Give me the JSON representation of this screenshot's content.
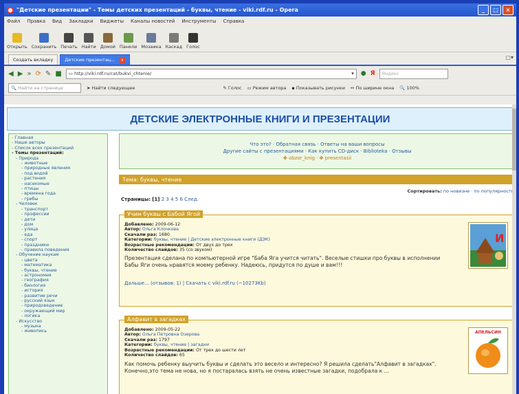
{
  "window": {
    "title": "\"Детские презентации\" - Темы детских презентаций - буквы, чтение - viki.rdf.ru - Opera"
  },
  "menu": [
    "Файл",
    "Правка",
    "Вид",
    "Закладки",
    "Виджеты",
    "Каналы новостей",
    "Инструменты",
    "Справка"
  ],
  "toolbar": [
    "Открыть",
    "Сохранить",
    "Печать",
    "Найти",
    "Домой",
    "Панели",
    "Мозаика",
    "Каскад",
    "Голос"
  ],
  "tabs": [
    {
      "label": "Создать вкладку"
    },
    {
      "label": "Детские презентац...",
      "close": "x"
    }
  ],
  "address": {
    "url": "http://viki.rdf.ru/cat/bukvi_chtenie/",
    "search_placeholder": "Яндекс"
  },
  "findbar": {
    "input": "Найти на странице",
    "find_next": "Найти следующее",
    "voice": "Голос",
    "author_mode": "Режим автора",
    "show_images": "Показывать рисунки",
    "fit_width": "По ширине окна",
    "zoom": "100%"
  },
  "page": {
    "banner": "ДЕТСКИЕ ЭЛЕКТРОННЫЕ КНИГИ И ПРЕЗЕНТАЦИИ",
    "sidebar": [
      {
        "t": "- Главная",
        "c": "l0"
      },
      {
        "t": "- Наши авторы",
        "c": "l0"
      },
      {
        "t": "- Список всех презентаций",
        "c": "l0"
      },
      {
        "t": "- Темы презентаций:",
        "c": "b"
      },
      {
        "t": "- Природа",
        "c": "l1"
      },
      {
        "t": "- животные",
        "c": "l2"
      },
      {
        "t": "- природные явления",
        "c": "l2"
      },
      {
        "t": "- под водой",
        "c": "l2"
      },
      {
        "t": "- растения",
        "c": "l2"
      },
      {
        "t": "- насекомые",
        "c": "l2"
      },
      {
        "t": "- птицы",
        "c": "l2"
      },
      {
        "t": "- времена года",
        "c": "l2"
      },
      {
        "t": "- грибы",
        "c": "l2"
      },
      {
        "t": "- Человек",
        "c": "l1"
      },
      {
        "t": "- транспорт",
        "c": "l2"
      },
      {
        "t": "- профессии",
        "c": "l2"
      },
      {
        "t": "- дети",
        "c": "l2"
      },
      {
        "t": "- дом",
        "c": "l2"
      },
      {
        "t": "- улица",
        "c": "l2"
      },
      {
        "t": "- еда",
        "c": "l2"
      },
      {
        "t": "- спорт",
        "c": "l2"
      },
      {
        "t": "- праздники",
        "c": "l2"
      },
      {
        "t": "- правила поведения",
        "c": "l2"
      },
      {
        "t": "- Обучение наукам",
        "c": "l1"
      },
      {
        "t": "- цвета",
        "c": "l2"
      },
      {
        "t": "- математика",
        "c": "l2"
      },
      {
        "t": "- буквы, чтение",
        "c": "l2"
      },
      {
        "t": "- астрономия",
        "c": "l2"
      },
      {
        "t": "- география",
        "c": "l2"
      },
      {
        "t": "- биология",
        "c": "l2"
      },
      {
        "t": "- история",
        "c": "l2"
      },
      {
        "t": "- развитие речи",
        "c": "l2"
      },
      {
        "t": "- русский язык",
        "c": "l2"
      },
      {
        "t": "- природоведение",
        "c": "l2"
      },
      {
        "t": "- окружающий мир",
        "c": "l2"
      },
      {
        "t": "- логика",
        "c": "l2"
      },
      {
        "t": "- Искусство",
        "c": "l1"
      },
      {
        "t": "- музыка",
        "c": "l2"
      },
      {
        "t": "- живопись",
        "c": "l2"
      }
    ],
    "toplinks": {
      "line1": "Что это? · Обратная связь · Ответы на ваши вопросы",
      "line2": "Другие сайты с презентациями · Как купить CD-диск · Biblioteka · Отзывы",
      "line3": "✤ obzor_knig · ✤ presentasii"
    },
    "section_title": "Тема: буквы, чтение",
    "sort": {
      "label": "Сортировать:",
      "options": "по новизне · по популярности"
    },
    "pages": {
      "label": "Страницы:",
      "current": "[1]",
      "rest": "2 3 4 5 6 След."
    },
    "cards": [
      {
        "title": "Учим буквы с Бабой Ягой",
        "meta": [
          [
            "Добавлено:",
            "2009-06-12"
          ],
          [
            "Автор:",
            "Ольга Клочкова"
          ],
          [
            "Скачали раз:",
            "1680"
          ],
          [
            "Категории:",
            "буквы, чтение | Детские электронные книги (ДЭК)"
          ],
          [
            "Возрастные рекомендации:",
            "От двух до трех"
          ],
          [
            "Количество слайдов:",
            "35 (со звуком)"
          ]
        ],
        "desc": "Презентация сделана по компьютерной игре \"Баба Яга учится читать\". Веселые стишки про буквы в исполнении Бабы Яги очень нравятся моему ребенку. Надеюсь, придутся по душе и вам!!!",
        "more": "Дальше... (отзывов: 1) | Скачать с viki.rdf.ru (~10273Kb)"
      },
      {
        "title": "Алфавит в загадках",
        "meta": [
          [
            "Добавлено:",
            "2009-05-22"
          ],
          [
            "Автор:",
            "Ольга Петровна Озерова"
          ],
          [
            "Скачали раз:",
            "1797"
          ],
          [
            "Категории:",
            "буквы, чтение | загадки"
          ],
          [
            "Возрастные рекомендации:",
            "От трех до шести лет"
          ],
          [
            "Количество слайдов:",
            "65"
          ]
        ],
        "desc": "Как помочь ребенку выучить буквы и сделать это весело и интересно? Я решила сделать\"Алфавит в загадках\". Конечно,это тема не нова, но я постаралась взять не очень известные загадки, подобрала к ...",
        "more": "",
        "thumb_label": "АПЕЛЬСИН"
      }
    ]
  }
}
